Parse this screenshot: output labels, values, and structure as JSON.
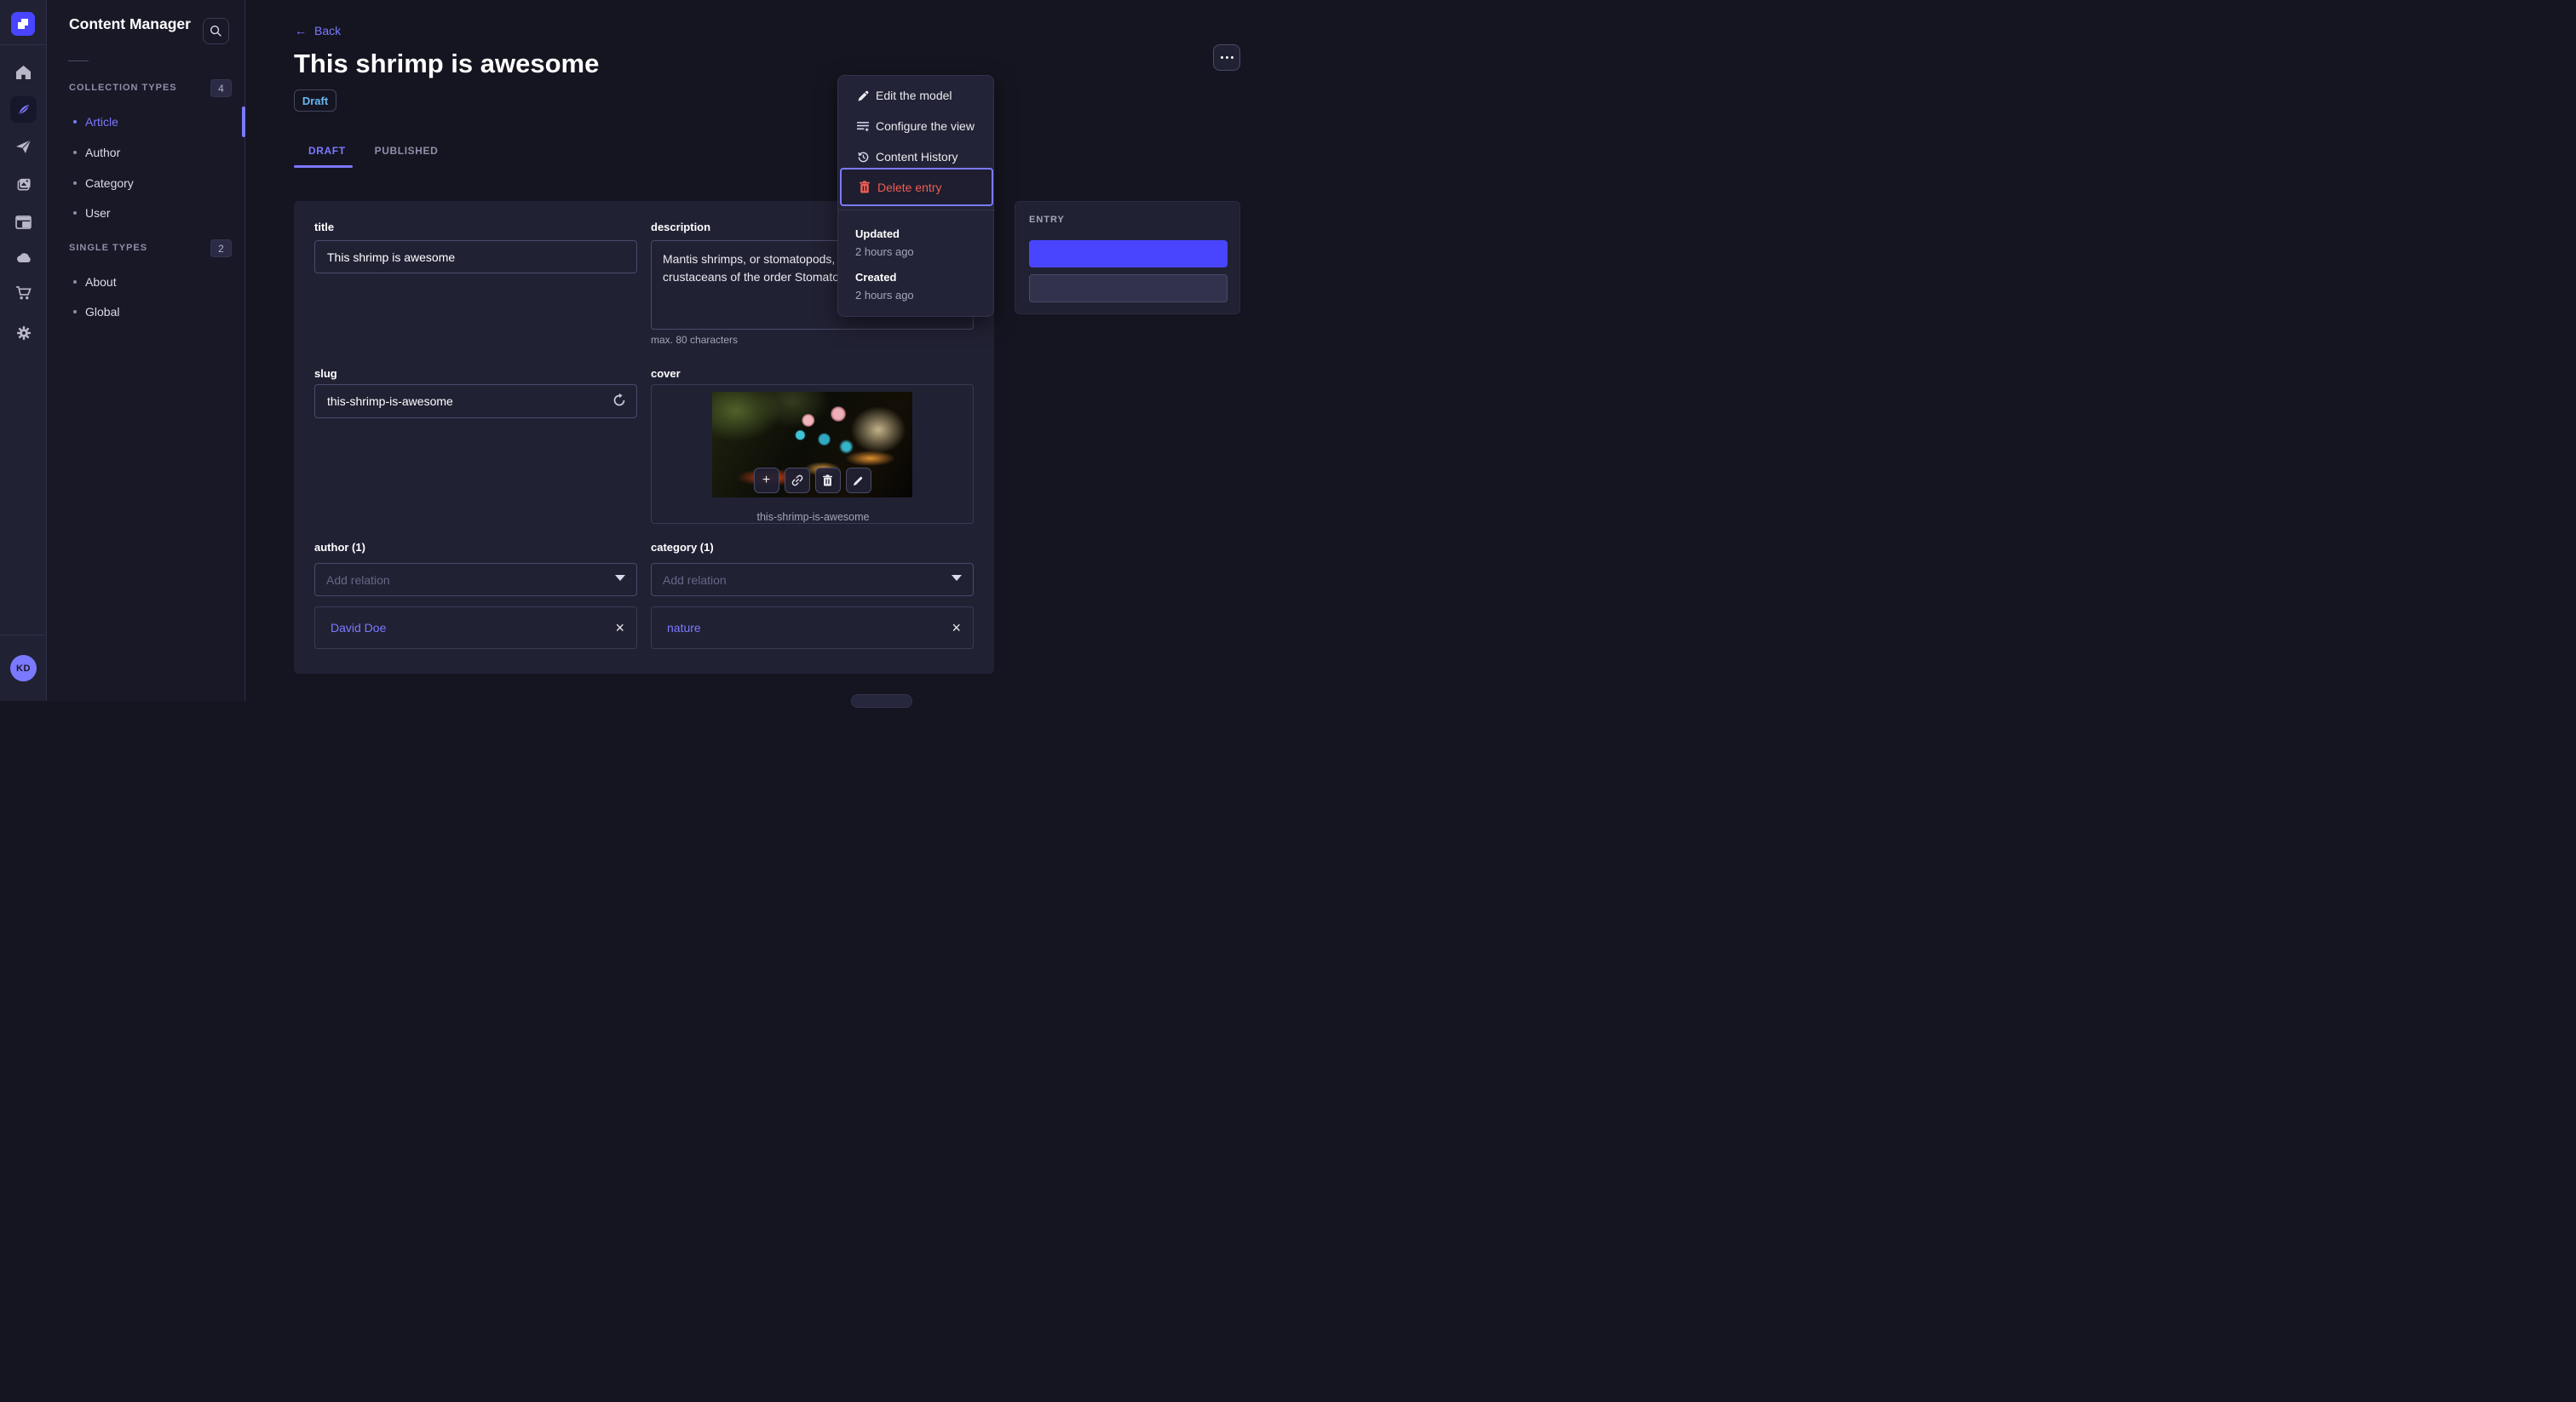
{
  "colors": {
    "accent": "#4945ff",
    "primary_light": "#7b79ff",
    "danger": "#ee5e52",
    "draft_blue": "#66b7f1",
    "panel_bg": "#212134",
    "content_bg": "#151521"
  },
  "main_nav": {
    "avatar_initials": "KD",
    "items": [
      {
        "icon": "home-icon"
      },
      {
        "icon": "feather-icon",
        "active": true
      },
      {
        "icon": "send-icon"
      },
      {
        "icon": "media-library-icon"
      },
      {
        "icon": "layout-builder-icon"
      },
      {
        "icon": "cloud-icon"
      },
      {
        "icon": "marketplace-cart-icon"
      },
      {
        "icon": "settings-gear-icon"
      }
    ]
  },
  "subnav": {
    "title": "Content Manager",
    "search_icon": "magnifier",
    "sections": [
      {
        "label": "COLLECTION TYPES",
        "count": "4",
        "items": [
          {
            "label": "Article",
            "active": true
          },
          {
            "label": "Author"
          },
          {
            "label": "Category"
          },
          {
            "label": "User"
          }
        ]
      },
      {
        "label": "SINGLE TYPES",
        "count": "2",
        "items": [
          {
            "label": "About"
          },
          {
            "label": "Global"
          }
        ]
      }
    ]
  },
  "header": {
    "back_label": "Back",
    "back_arrow": "←",
    "title": "This shrimp is awesome",
    "status": "Draft",
    "tabs": [
      {
        "label": "DRAFT",
        "active": true
      },
      {
        "label": "PUBLISHED"
      }
    ]
  },
  "form": {
    "title_field": {
      "label": "title",
      "value": "This shrimp is awesome"
    },
    "description_field": {
      "label": "description",
      "value": "Mantis shrimps, or stomatopods, are marine crustaceans of the order Stomatopoda.",
      "hint": "max. 80 characters"
    },
    "slug_field": {
      "label": "slug",
      "value": "this-shrimp-is-awesome",
      "action_icon": "regenerate-icon"
    },
    "cover_field": {
      "label": "cover",
      "filename": "this-shrimp-is-awesome",
      "action_icons": [
        "add-icon",
        "link-icon",
        "trash-icon",
        "edit-pencil-icon"
      ],
      "add_glyph": "+"
    },
    "author_field": {
      "label": "author (1)",
      "placeholder": "Add relation",
      "relation": "David Doe",
      "remove_glyph": "×"
    },
    "category_field": {
      "label": "category (1)",
      "placeholder": "Add relation",
      "relation": "nature",
      "remove_glyph": "×"
    }
  },
  "entry_panel": {
    "label": "ENTRY"
  },
  "context_menu": {
    "items": [
      {
        "label": "Edit the model",
        "icon": "pencil-icon"
      },
      {
        "label": "Configure the view",
        "icon": "configure-list-icon"
      },
      {
        "label": "Content History",
        "icon": "history-clock-icon"
      },
      {
        "label": "Delete entry",
        "icon": "trash-icon",
        "danger": true,
        "highlighted": true
      }
    ],
    "meta": [
      {
        "label": "Updated",
        "value": "2 hours ago"
      },
      {
        "label": "Created",
        "value": "2 hours ago"
      }
    ]
  }
}
